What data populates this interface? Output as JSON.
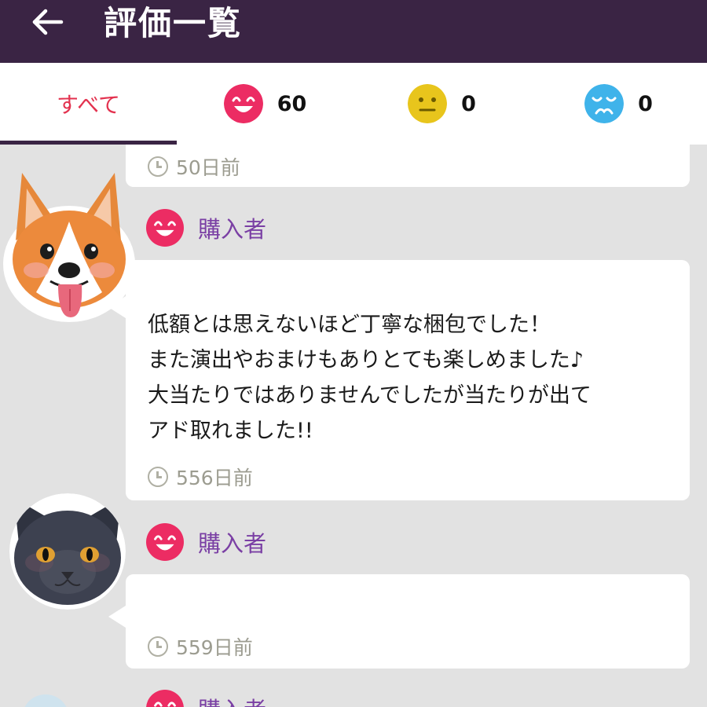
{
  "header": {
    "title": "評価一覧",
    "back_icon": "arrow-left-icon"
  },
  "tabs": [
    {
      "label": "すべて",
      "selected": true
    },
    {
      "icon": "happy-face-icon",
      "count": "60",
      "color": "#ec2c63"
    },
    {
      "icon": "neutral-face-icon",
      "count": "0",
      "color": "#e8c51c"
    },
    {
      "icon": "sad-face-icon",
      "count": "0",
      "color": "#3fb3ea"
    }
  ],
  "reviews": [
    {
      "time": "50日前"
    },
    {
      "reviewer": "購入者",
      "rating_icon": "happy-face-icon",
      "avatar": "corgi-avatar",
      "comment": "低額とは思えないほど丁寧な梱包でした！\nまた演出やおまけもありとても楽しめました♪\n大当たりではありませんでしたが当たりが出て\nアド取れました!!",
      "time": "556日前"
    },
    {
      "reviewer": "購入者",
      "rating_icon": "happy-face-icon",
      "avatar": "cat-avatar",
      "comment": "",
      "time": "559日前"
    },
    {
      "reviewer": "購入者",
      "rating_icon": "happy-face-icon"
    }
  ]
}
